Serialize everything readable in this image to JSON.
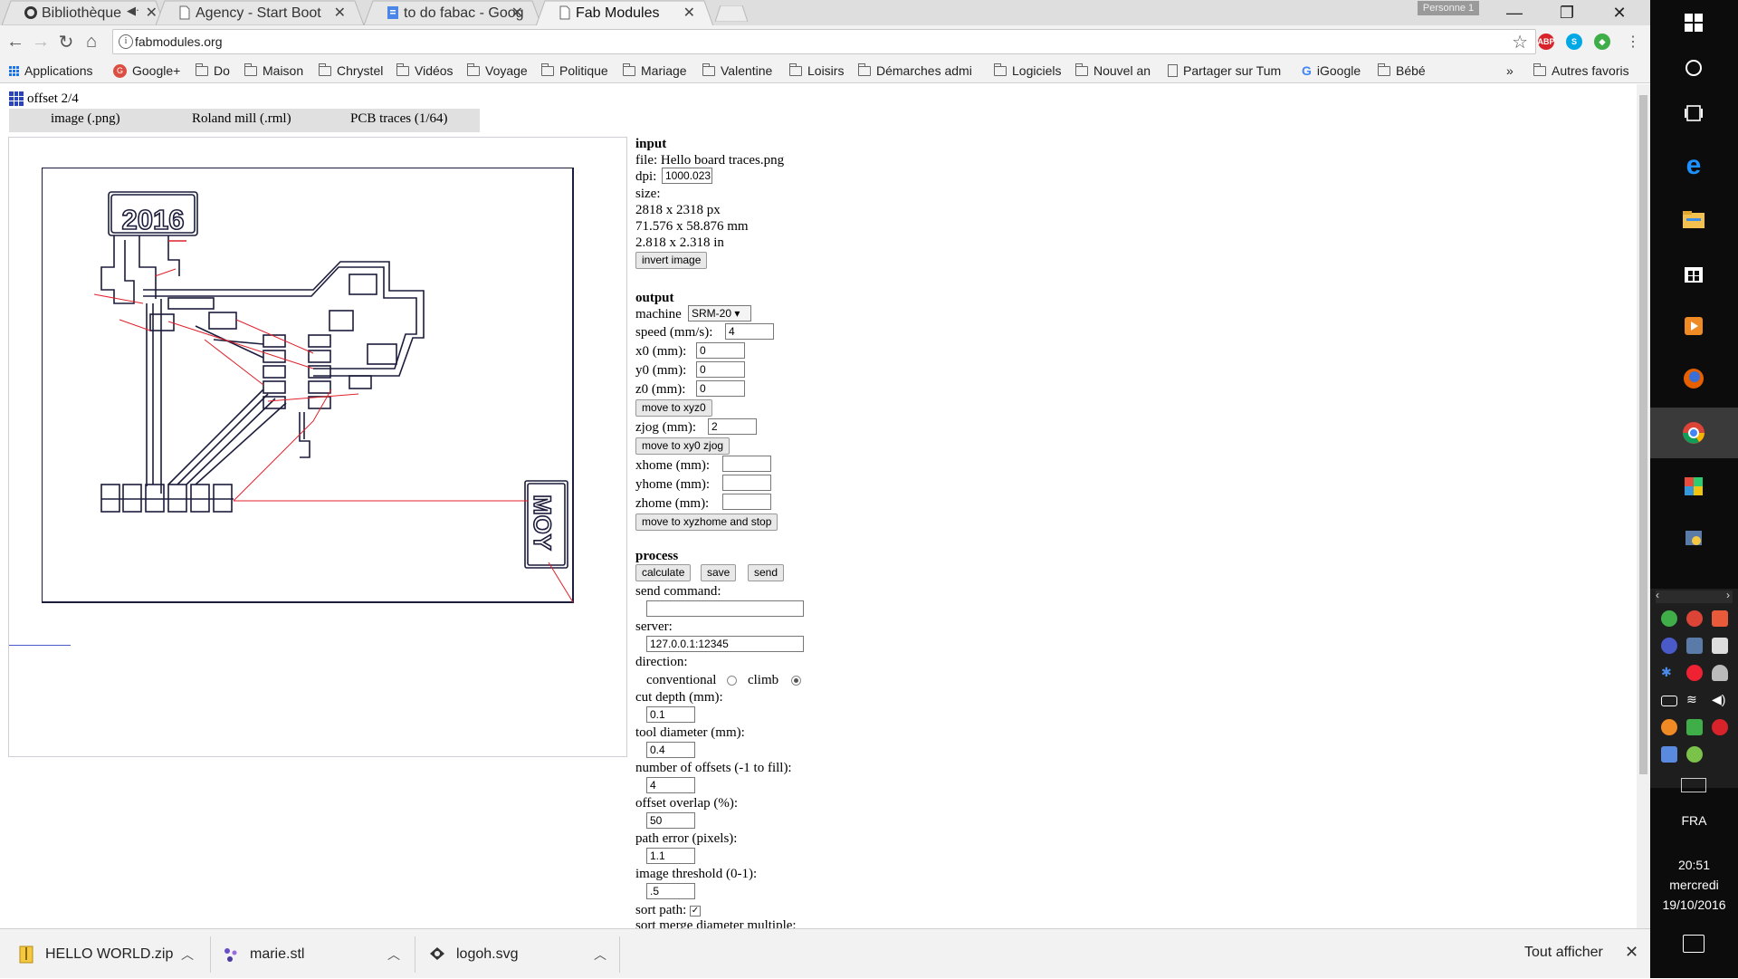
{
  "browser": {
    "tabs": [
      {
        "title": "Bibliothèque | Ne",
        "icon": "github-icon"
      },
      {
        "title": "Agency - Start Boot",
        "icon": "page-icon"
      },
      {
        "title": "to do fabac - Googl",
        "icon": "docs-icon"
      },
      {
        "title": "Fab Modules",
        "icon": "page-icon",
        "active": true
      }
    ],
    "profile_badge": "Personne 1",
    "url": "fabmodules.org",
    "bookmarks": [
      {
        "label": "Applications",
        "icon": "apps-grid-icon"
      },
      {
        "label": "Google+",
        "icon": "google-plus-icon"
      },
      {
        "label": "Do",
        "icon": "folder-icon"
      },
      {
        "label": "Maison",
        "icon": "folder-icon"
      },
      {
        "label": "Chrystel",
        "icon": "folder-icon"
      },
      {
        "label": "Vidéos",
        "icon": "folder-icon"
      },
      {
        "label": "Voyage",
        "icon": "folder-icon"
      },
      {
        "label": "Politique",
        "icon": "folder-icon"
      },
      {
        "label": "Mariage",
        "icon": "folder-icon"
      },
      {
        "label": "Valentine",
        "icon": "folder-icon"
      },
      {
        "label": "Loisirs",
        "icon": "folder-icon"
      },
      {
        "label": "Démarches admi",
        "icon": "folder-icon"
      },
      {
        "label": "Logiciels",
        "icon": "folder-icon"
      },
      {
        "label": "Nouvel an",
        "icon": "folder-icon"
      },
      {
        "label": "Partager sur Tum",
        "icon": "page-icon"
      },
      {
        "label": "iGoogle",
        "icon": "google-icon"
      },
      {
        "label": "Bébé",
        "icon": "folder-icon"
      }
    ],
    "more": "»",
    "other_bookmarks": "Autres favoris"
  },
  "page": {
    "title": "offset 2/4",
    "module_tabs": [
      "image (.png)",
      "Roland mill (.rml)",
      "PCB traces (1/64)"
    ],
    "pcb_text": {
      "year": "2016",
      "name": "MOY"
    },
    "input": {
      "heading": "input",
      "file_label": "file:",
      "file": "Hello board traces.png",
      "dpi_label": "dpi:",
      "dpi": "1000.023",
      "size_label": "size:",
      "size_px": "2818 x 2318 px",
      "size_mm": "71.576 x 58.876 mm",
      "size_in": "2.818 x 2.318 in",
      "invert_button": "invert image"
    },
    "output": {
      "heading": "output",
      "machine_label": "machine",
      "machine": "SRM-20",
      "speed_label": "speed (mm/s):",
      "speed": "4",
      "x0_label": "x0 (mm):",
      "x0": "0",
      "y0_label": "y0 (mm):",
      "y0": "0",
      "z0_label": "z0 (mm):",
      "z0": "0",
      "move_xyz0": "move to xyz0",
      "zjog_label": "zjog (mm):",
      "zjog": "2",
      "move_xy0_zjog": "move to xy0 zjog",
      "xhome_label": "xhome (mm):",
      "yhome_label": "yhome (mm):",
      "zhome_label": "zhome (mm):",
      "move_home": "move to xyzhome and stop"
    },
    "process": {
      "heading": "process",
      "calculate": "calculate",
      "save": "save",
      "send": "send",
      "send_command_label": "send command:",
      "send_command": "",
      "server_label": "server:",
      "server": "127.0.0.1:12345",
      "direction_label": "direction:",
      "conventional": "conventional",
      "climb": "climb",
      "cut_depth_label": "cut depth (mm):",
      "cut_depth": "0.1",
      "tool_diameter_label": "tool diameter (mm):",
      "tool_diameter": "0.4",
      "offsets_label": "number of offsets (-1 to fill):",
      "offsets": "4",
      "overlap_label": "offset overlap (%):",
      "overlap": "50",
      "path_error_label": "path error (pixels):",
      "path_error": "1.1",
      "threshold_label": "image threshold (0-1):",
      "threshold": ".5",
      "sort_path_label": "sort path:",
      "sort_merge_label": "sort merge diameter multiple:"
    }
  },
  "downloads": {
    "items": [
      {
        "name": "HELLO WORLD.zip",
        "icon": "zip-icon"
      },
      {
        "name": "marie.stl",
        "icon": "stl-icon"
      },
      {
        "name": "logoh.svg",
        "icon": "svg-file-icon"
      }
    ],
    "show_all": "Tout afficher"
  },
  "taskbar": {
    "language": "FRA",
    "time": "20:51",
    "day": "mercredi",
    "date": "19/10/2016"
  },
  "colors": {
    "trace": "#1c1c3c",
    "rapid_move": "#e0202a",
    "accent_blue": "#2b44b8",
    "taskbar_bg": "#0c0c0c"
  }
}
